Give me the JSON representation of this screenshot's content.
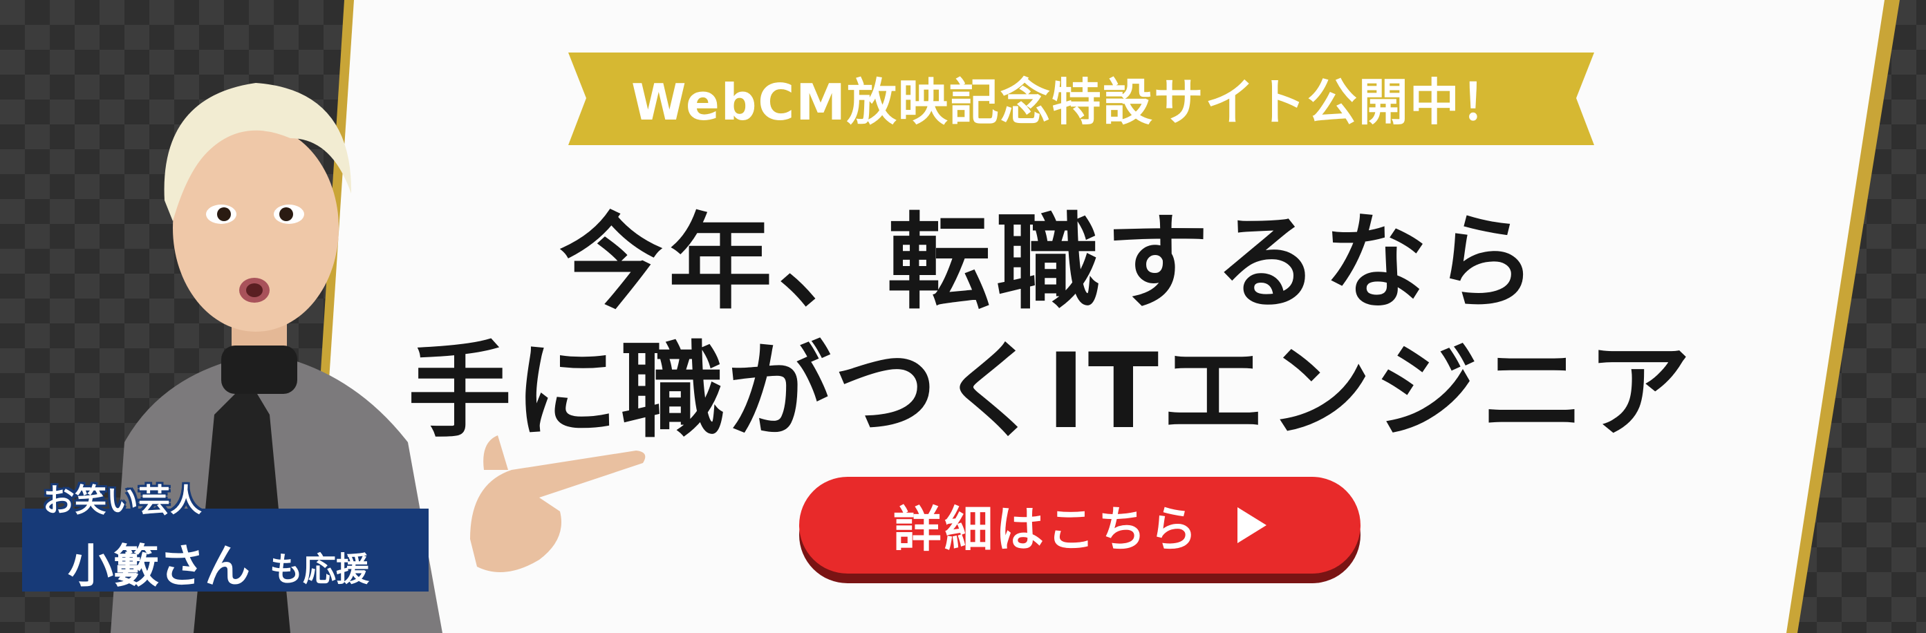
{
  "banner": {
    "ribbon_text": "WebCM放映記念特設サイト公開中！",
    "headline_line1": "今年、転職するなら",
    "headline_line2": "手に職がつくITエンジニア",
    "cta_label": "詳細はこちら",
    "cta_icon": "play-triangle-icon",
    "badge": {
      "top": "お笑い芸人",
      "name": "小籔さん",
      "suffix": "も応援"
    }
  },
  "colors": {
    "ribbon_gold": "#d6b832",
    "accent_gold": "#c9a537",
    "cta_red": "#e82a2a",
    "badge_navy": "#173a78",
    "headline": "#161616",
    "background_dark": "#3a3a3a"
  }
}
